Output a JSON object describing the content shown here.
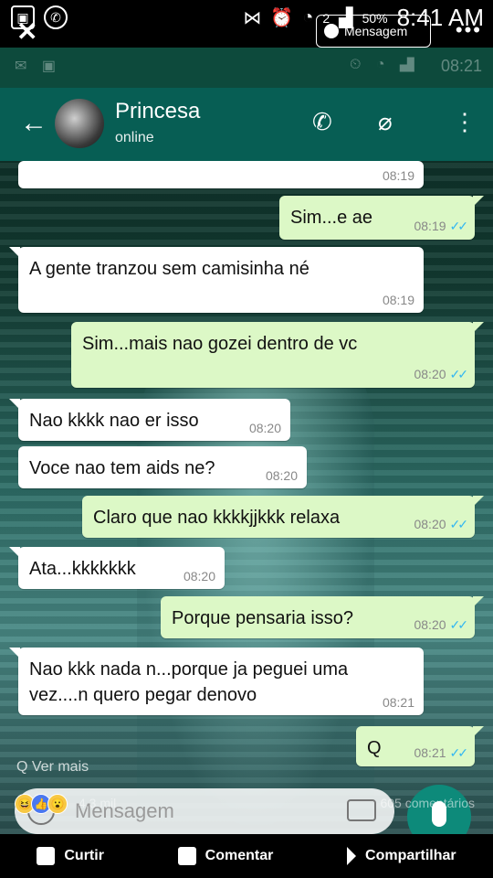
{
  "phone_status": {
    "battery": "50%",
    "time": "8:41 AM",
    "sim": "2"
  },
  "facebook": {
    "close_label": "✕",
    "messenger_label": "Mensagem",
    "more_label": "•••",
    "ver_mais": "Ver mais",
    "reaction_count": "4,3 mil",
    "comments": "605 comentários",
    "actions": [
      {
        "label": "Curtir",
        "icon": "like-icon"
      },
      {
        "label": "Comentar",
        "icon": "comment-icon"
      },
      {
        "label": "Compartilhar",
        "icon": "share-icon"
      }
    ]
  },
  "whatsapp": {
    "inner_status_time": "08:21",
    "contact_name": "Princesa",
    "contact_status": "online",
    "input_placeholder": "Mensagem",
    "messages": [
      {
        "dir": "in",
        "text": "",
        "time": "08:19"
      },
      {
        "dir": "out",
        "text": "Sim...e ae",
        "time": "08:19"
      },
      {
        "dir": "in",
        "text": "A gente tranzou sem camisinha né",
        "time": "08:19"
      },
      {
        "dir": "out",
        "text": "Sim...mais nao gozei dentro de vc",
        "time": "08:20"
      },
      {
        "dir": "in",
        "text": "Nao kkkk nao er isso",
        "time": "08:20"
      },
      {
        "dir": "in",
        "text": "Voce nao tem aids ne?",
        "time": "08:20"
      },
      {
        "dir": "out",
        "text": "Claro que nao kkkkjjkkk relaxa",
        "time": "08:20"
      },
      {
        "dir": "in",
        "text": "Ata...kkkkkkk",
        "time": "08:20"
      },
      {
        "dir": "out",
        "text": "Porque pensaria isso?",
        "time": "08:20"
      },
      {
        "dir": "in",
        "text": "Nao kkk nada n...porque ja peguei uma vez....n quero pegar denovo",
        "time": "08:21"
      },
      {
        "dir": "out",
        "text": "Q",
        "time": "08:21"
      }
    ]
  },
  "colors": {
    "wa_header": "#075e54",
    "bubble_out": "#dcf8c6",
    "bubble_in": "#ffffff",
    "read_ticks": "#34b7f1"
  }
}
